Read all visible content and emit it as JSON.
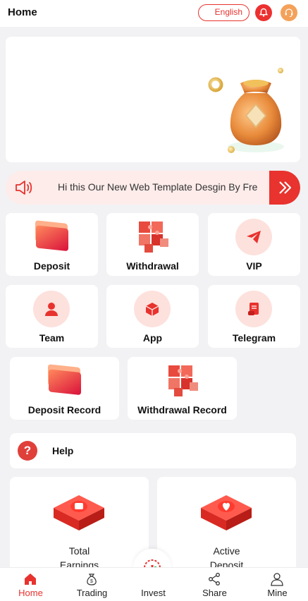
{
  "header": {
    "title": "Home",
    "language_label": "English",
    "notification_icon": "bell-icon",
    "support_icon": "headset-icon"
  },
  "banner": {
    "image": "gold-money-bag-illustration"
  },
  "announcement": {
    "text": "Hi this Our New Web Template Desgin By Fre",
    "icon": "speaker-icon",
    "action_icon": "double-chevron-right-icon"
  },
  "quick_actions": [
    {
      "label": "Deposit",
      "icon": "card-stack-icon"
    },
    {
      "label": "Withdrawal",
      "icon": "puzzle-blocks-icon"
    },
    {
      "label": "VIP",
      "icon": "paper-plane-icon"
    },
    {
      "label": "Team",
      "icon": "person-icon"
    },
    {
      "label": "App",
      "icon": "cube-icon"
    },
    {
      "label": "Telegram",
      "icon": "scroll-icon"
    },
    {
      "label": "Deposit Record",
      "icon": "card-stack-icon"
    },
    {
      "label": "Withdrawal Record",
      "icon": "puzzle-blocks-icon"
    }
  ],
  "help": {
    "label": "Help",
    "icon": "question-icon"
  },
  "stats": [
    {
      "label_line1": "Total",
      "label_line2": "Earnings",
      "icon": "wallet-platform-icon"
    },
    {
      "label_line1": "Active",
      "label_line2": "Deposit",
      "icon": "heart-platform-icon"
    }
  ],
  "bottom_nav": [
    {
      "label": "Home",
      "icon": "home-icon",
      "active": true
    },
    {
      "label": "Trading",
      "icon": "money-bag-icon",
      "active": false
    },
    {
      "label": "Invest",
      "icon": "chart-circle-icon",
      "active": false
    },
    {
      "label": "Share",
      "icon": "share-icon",
      "active": false
    },
    {
      "label": "Mine",
      "icon": "user-icon",
      "active": false
    }
  ],
  "colors": {
    "accent": "#e8322e",
    "background": "#f2f2f4",
    "card": "#ffffff"
  }
}
